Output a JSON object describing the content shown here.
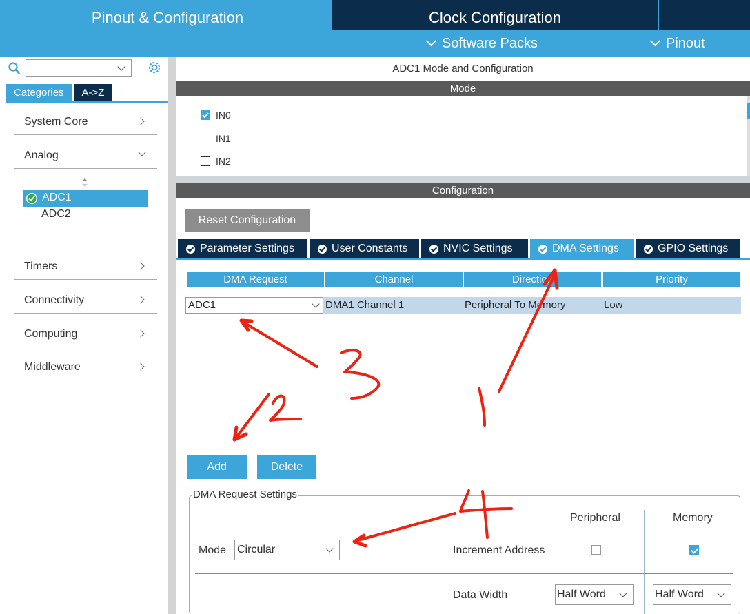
{
  "top_tabs": {
    "pinout": "Pinout & Configuration",
    "clock": "Clock Configuration"
  },
  "subbar": {
    "software_packs": "Software Packs",
    "pinout": "Pinout"
  },
  "sidebar": {
    "search_value": "",
    "tabs": [
      "Categories",
      "A->Z"
    ],
    "categories": [
      {
        "label": "System Core",
        "expanded": false
      },
      {
        "label": "Analog",
        "expanded": true
      },
      {
        "label": "Timers",
        "expanded": false
      },
      {
        "label": "Connectivity",
        "expanded": false
      },
      {
        "label": "Computing",
        "expanded": false
      },
      {
        "label": "Middleware",
        "expanded": false
      }
    ],
    "analog_items": [
      "ADC1",
      "ADC2"
    ]
  },
  "content": {
    "title": "ADC1 Mode and Configuration",
    "mode_header": "Mode",
    "channels": [
      {
        "label": "IN0",
        "checked": true
      },
      {
        "label": "IN1",
        "checked": false
      },
      {
        "label": "IN2",
        "checked": false
      }
    ],
    "config_header": "Configuration",
    "reset_button": "Reset Configuration",
    "config_tabs": [
      "Parameter Settings",
      "User Constants",
      "NVIC Settings",
      "DMA Settings",
      "GPIO Settings"
    ],
    "active_tab": "DMA Settings",
    "dma_table": {
      "headers": [
        "DMA Request",
        "Channel",
        "Direction",
        "Priority"
      ],
      "rows": [
        {
          "request": "ADC1",
          "channel": "DMA1 Channel 1",
          "direction": "Peripheral To Memory",
          "priority": "Low"
        }
      ]
    },
    "add_button": "Add",
    "delete_button": "Delete",
    "settings": {
      "legend": "DMA Request Settings",
      "peripheral_header": "Peripheral",
      "memory_header": "Memory",
      "mode_label": "Mode",
      "mode_value": "Circular",
      "increment_label": "Increment Address",
      "peripheral_increment": false,
      "memory_increment": true,
      "data_width_label": "Data Width",
      "peripheral_width": "Half Word",
      "memory_width": "Half Word"
    }
  },
  "annotations": {
    "color": "#ee2211",
    "labels": [
      "1",
      "2",
      "3",
      "4"
    ]
  },
  "colors": {
    "accent": "#3ca5d9",
    "navy": "#0b2d4b",
    "section": "#5a5a5a"
  }
}
